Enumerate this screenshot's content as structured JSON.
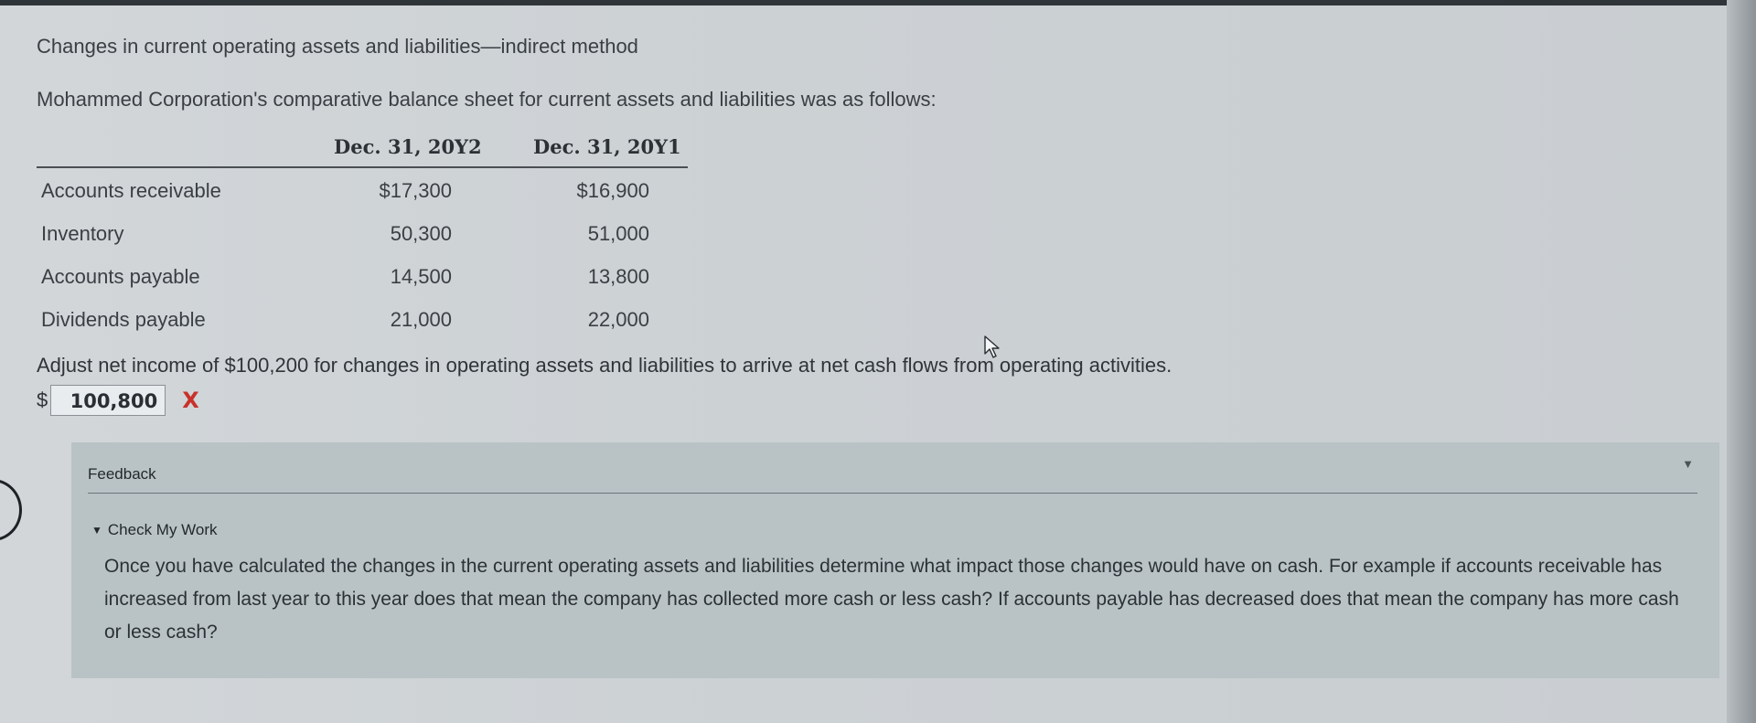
{
  "problem": {
    "title": "Changes in current operating assets and liabilities—indirect method",
    "intro": "Mohammed Corporation's comparative balance sheet for current assets and liabilities was as follows:"
  },
  "balance_sheet": {
    "columns": [
      "Dec. 31, 20Y2",
      "Dec. 31, 20Y1"
    ],
    "rows": [
      {
        "label": "Accounts receivable",
        "y2": "$17,300",
        "y1": "$16,900"
      },
      {
        "label": "Inventory",
        "y2": "50,300",
        "y1": "51,000"
      },
      {
        "label": "Accounts payable",
        "y2": "14,500",
        "y1": "13,800"
      },
      {
        "label": "Dividends payable",
        "y2": "21,000",
        "y1": "22,000"
      }
    ]
  },
  "question": {
    "text": "Adjust net income of $100,200 for changes in operating assets and liabilities to arrive at net cash flows from operating activities.",
    "currency_symbol": "$",
    "answer_value": "100,800",
    "result_mark": "X",
    "result_color": "#c8322a"
  },
  "feedback": {
    "label": "Feedback",
    "toggle_icon": "▼",
    "check_my_work_label": "Check My Work",
    "check_my_work_icon": "▼",
    "body": "Once you have calculated the changes in the current operating assets and liabilities determine what impact those changes would have on cash. For example if accounts receivable has increased from last year to this year does that mean the company has collected more cash or less cash? If accounts payable has decreased does that mean the company has more cash or less cash?"
  }
}
